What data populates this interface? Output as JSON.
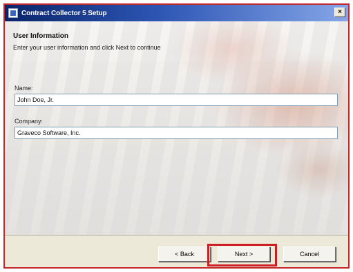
{
  "window": {
    "title": "Contract Collector 5 Setup",
    "close_label": "×"
  },
  "header": {
    "title": "User Information",
    "subtitle": "Enter your user information and click Next to continue"
  },
  "form": {
    "name_label": "Name:",
    "name_value": "John Doe, Jr.",
    "company_label": "Company:",
    "company_value": "Graveco Software, Inc."
  },
  "buttons": {
    "back_label": "< Back",
    "next_label": "Next >",
    "cancel_label": "Cancel"
  },
  "colors": {
    "title_bar": "#0a246a",
    "highlight": "#cc1f24"
  }
}
